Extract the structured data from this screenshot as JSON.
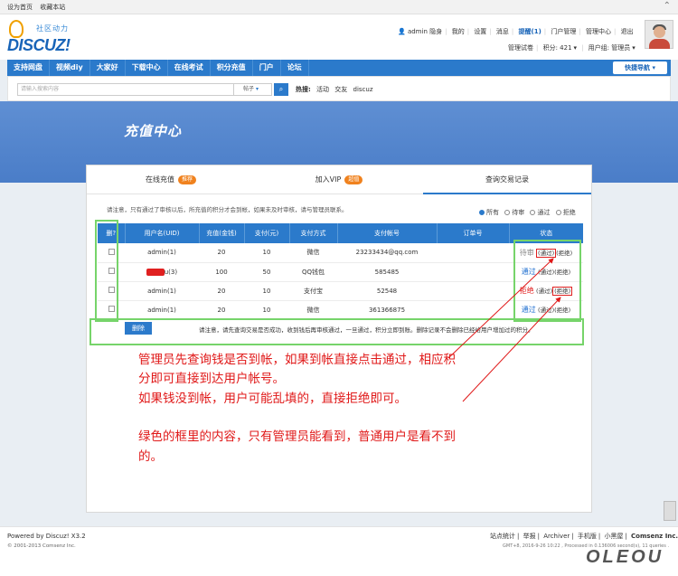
{
  "topbar": {
    "set_home": "设为首页",
    "bookmark": "收藏本站"
  },
  "logo": {
    "slogan": "社区动力",
    "brand": "DISCUZ!"
  },
  "userbar": {
    "username": "admin",
    "invisible": "隐身",
    "mine": "我的",
    "settings": "设置",
    "messages": "消息",
    "reminder": "提醒(1)",
    "portal_mgmt": "门户管理",
    "admin_center": "管理中心",
    "logout": "退出",
    "mode": "管理试卷",
    "credits": "积分: 421",
    "usergroup": "用户组: 管理员"
  },
  "nav": {
    "items": [
      "支持网盘",
      "视频diy",
      "大家好",
      "下载中心",
      "在线考试",
      "积分充值",
      "门户",
      "论坛"
    ],
    "quick": "快捷导航"
  },
  "search": {
    "placeholder": "请输入搜索内容",
    "type": "帖子",
    "hot_label": "热搜:",
    "hot_items": [
      "活动",
      "交友",
      "discuz"
    ]
  },
  "banner": {
    "title": "充值中心"
  },
  "tabs": {
    "online": "在线充值",
    "online_tag": "推荐",
    "vip": "加入VIP",
    "vip_tag": "超值",
    "records": "查询交易记录"
  },
  "notice": "请注意，只有通过了审核以后，所充值的积分才会到帐，如果未及时审核，请与管理员联系。",
  "filters": [
    "所有",
    "待审",
    "通过",
    "拒绝"
  ],
  "table": {
    "headers": [
      "删?",
      "用户名(UID)",
      "充值(金钱)",
      "支付(元)",
      "支付方式",
      "支付帐号",
      "订单号",
      "状态"
    ],
    "rows": [
      {
        "user": "admin(1)",
        "amount": "20",
        "pay": "10",
        "method": "微信",
        "account": "23233434@qq.com",
        "order": "",
        "status": "待审",
        "pass": "(通过)",
        "reject": "(拒绝)"
      },
      {
        "user": "u(3)",
        "amount": "100",
        "pay": "50",
        "method": "QQ钱包",
        "account": "585485",
        "order": "",
        "status": "通过",
        "pass": "(通过)",
        "reject": "(拒绝)"
      },
      {
        "user": "admin(1)",
        "amount": "20",
        "pay": "10",
        "method": "支付宝",
        "account": "52548",
        "order": "",
        "status": "拒绝",
        "pass": "(通过)",
        "reject": "(拒绝)"
      },
      {
        "user": "admin(1)",
        "amount": "20",
        "pay": "10",
        "method": "微信",
        "account": "361366875",
        "order": "",
        "status": "通过",
        "pass": "(通过)",
        "reject": "(拒绝)"
      }
    ]
  },
  "bottom": {
    "delete": "删除",
    "note": "请注意，请先查询交易是否成功，收到钱后再审核通过，一旦通过，积分立即到账。删除记录不会删除已经给用户增加过的积分。"
  },
  "annotation": {
    "line1": "管理员先查询钱是否到帐，如果到帐直接点击通过，相应积",
    "line2": "分即可直接到达用户帐号。",
    "line3": "如果钱没到帐，用户可能乱填的，直接拒绝即可。",
    "line4": "绿色的框里的内容，只有管理员能看到，普通用户是看不到",
    "line5": "的。"
  },
  "footer": {
    "powered": "Powered by Discuz! X3.2",
    "copyright": "© 2001-2013 Comsenz Inc.",
    "links": [
      "站点统计",
      "举报",
      "Archiver",
      "手机版",
      "小黑屋",
      "Comsenz Inc."
    ],
    "gmt": "GMT+8, 2016-9-26 10:22 , Processed in 0.136006 second(s), 11 queries ."
  },
  "watermark": "OLEOU",
  "colors": {
    "primary": "#2b7acb",
    "annotation": "#e01818",
    "highlight": "#76d46a"
  }
}
